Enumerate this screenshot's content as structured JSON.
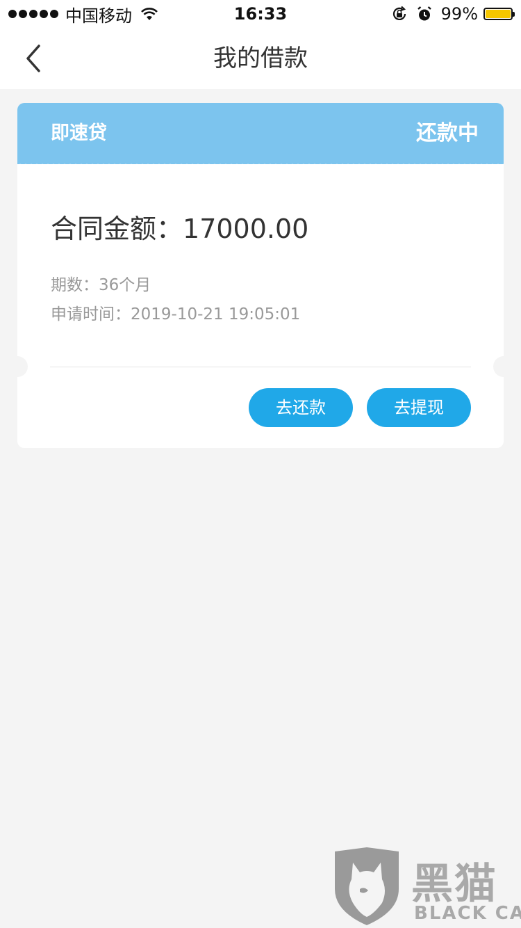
{
  "status_bar": {
    "carrier": "中国移动",
    "time": "16:33",
    "battery_text": "99%",
    "battery_level": 0.99,
    "icons": [
      "signal-dots-icon",
      "wifi-icon",
      "rotation-lock-icon",
      "alarm-icon",
      "battery-icon"
    ]
  },
  "nav": {
    "title": "我的借款",
    "back_icon": "chevron-left-icon"
  },
  "loan_card": {
    "product": "即速贷",
    "status": "还款中",
    "amount_label": "合同金额：",
    "amount_value": "17000.00",
    "term_label": "期数：",
    "term_value": "36个月",
    "apply_time_label": "申请时间：",
    "apply_time_value": "2019-10-21 19:05:01",
    "repay_button": "去还款",
    "withdraw_button": "去提现"
  },
  "watermark": {
    "text_cn": "黑猫",
    "text_en": "BLACK CAT"
  },
  "colors": {
    "card_header": "#7cc4ee",
    "button": "#20a8e8",
    "background": "#f4f4f4",
    "battery": "#f6c700"
  }
}
